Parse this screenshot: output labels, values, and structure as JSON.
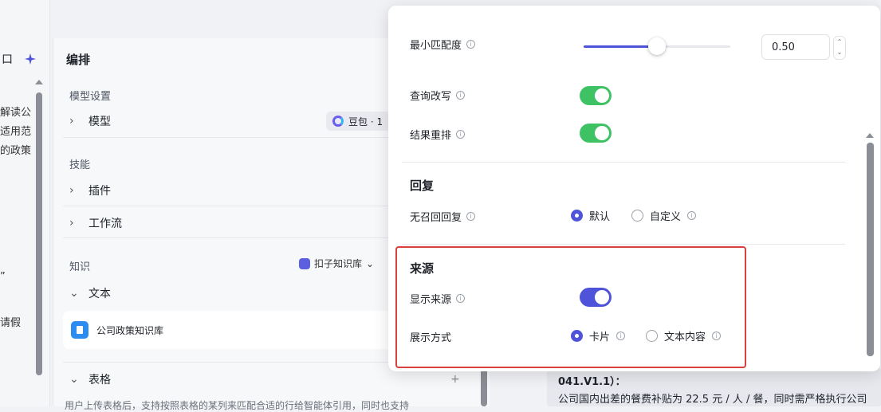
{
  "left_prompt": {
    "header_text": "口",
    "lines": [
      "解读公",
      "适用范",
      "的政策",
      "”",
      "请假"
    ]
  },
  "arrange": {
    "title": "编排",
    "model_settings_label": "模型设置",
    "model_label": "模型",
    "model_value": "豆包 · 1",
    "skills_label": "技能",
    "plugins_label": "插件",
    "workflow_label": "工作流",
    "knowledge_label": "知识",
    "knowledge_source": "扣子知识库",
    "text_label": "文本",
    "kb_name": "公司政策知识库",
    "table_label": "表格",
    "table_desc": "用户上传表格后，支持按照表格的某列来匹配合适的行给智能体引用，同时也支持"
  },
  "preview": {
    "answer_line1": "041.V1.1）：",
    "answer_line2": "公司国内出差的餐费补贴为 22.5 元 / 人 / 餐，同时需严格执行公司"
  },
  "popover": {
    "min_match_label": "最小匹配度",
    "min_match_value": "0.50",
    "min_match_fraction": 0.5,
    "query_rewrite_label": "查询改写",
    "query_rewrite_on": true,
    "rerank_label": "结果重排",
    "rerank_on": true,
    "reply_section": "回复",
    "no_recall_label": "无召回回复",
    "reply_default": "默认",
    "reply_custom": "自定义",
    "source_section": "来源",
    "show_source_label": "显示来源",
    "show_source_on": true,
    "display_mode_label": "展示方式",
    "display_card": "卡片",
    "display_text": "文本内容"
  },
  "colors": {
    "accent": "#4e53d9",
    "toggle_green": "#3ec264",
    "highlight_red": "#d9413f"
  }
}
